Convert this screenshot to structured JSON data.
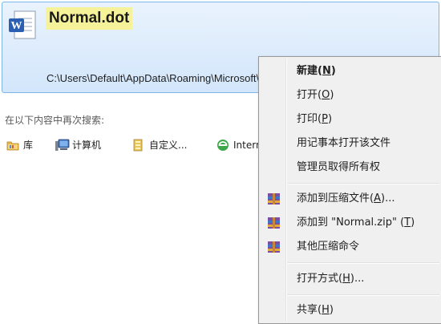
{
  "result": {
    "file_name": "Normal.dot",
    "path": "C:\\Users\\Default\\AppData\\Roaming\\Microsoft\\Templates",
    "icon": "word-document-icon"
  },
  "search_again": {
    "label": "在以下内容中再次搜索:",
    "locations": [
      {
        "label": "库",
        "icon": "library-icon"
      },
      {
        "label": "计算机",
        "icon": "computer-icon"
      },
      {
        "label": "自定义...",
        "icon": "custom-folder-icon"
      },
      {
        "label": "Internet",
        "icon": "internet-icon"
      }
    ]
  },
  "context_menu": {
    "items": [
      {
        "text": "新建",
        "key": "N",
        "suffix": "",
        "bold": true,
        "icon": ""
      },
      {
        "text": "打开",
        "key": "O",
        "suffix": "",
        "bold": false,
        "icon": ""
      },
      {
        "text": "打印",
        "key": "P",
        "suffix": "",
        "bold": false,
        "icon": ""
      },
      {
        "text": "用记事本打开该文件",
        "key": "",
        "suffix": "",
        "bold": false,
        "icon": ""
      },
      {
        "text": "管理员取得所有权",
        "key": "",
        "suffix": "",
        "bold": false,
        "icon": ""
      },
      {
        "text": "添加到压缩文件",
        "key": "A",
        "suffix": "...",
        "bold": false,
        "icon": "winrar-archive-icon"
      },
      {
        "text": "添加到 \"Normal.zip\"",
        "key": "T",
        "suffix": "",
        "bold": false,
        "icon": "winrar-archive-icon"
      },
      {
        "text": "其他压缩命令",
        "key": "",
        "suffix": "",
        "bold": false,
        "icon": "winrar-archive-icon"
      },
      {
        "text": "打开方式",
        "key": "H",
        "suffix": "...",
        "bold": false,
        "icon": ""
      },
      {
        "text": "共享",
        "key": "H",
        "suffix": "",
        "bold": false,
        "icon": ""
      }
    ]
  },
  "colors": {
    "selection_bg": "#d3e6fb",
    "selection_border": "#7fb4e8",
    "highlight": "#f6f29a",
    "menu_bg": "#f0f0f0"
  }
}
